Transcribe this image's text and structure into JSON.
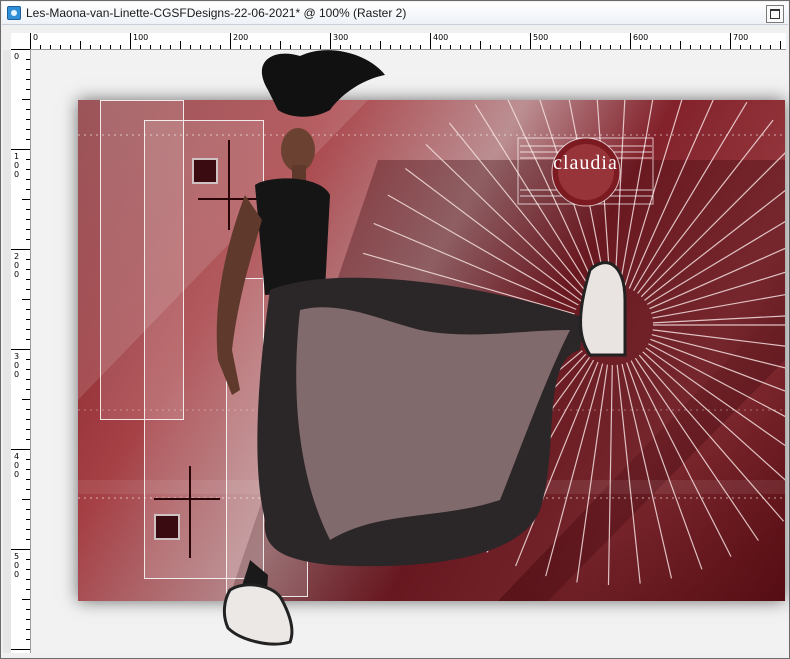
{
  "window": {
    "title": "Les-Maona-van-Linette-CGSFDesigns-22-06-2021* @ 100% (Raster 2)"
  },
  "ruler_top": {
    "labels": [
      "0",
      "100",
      "200",
      "300",
      "400",
      "500",
      "600",
      "700"
    ]
  },
  "ruler_left": {
    "labels": [
      "0",
      "100",
      "200",
      "300",
      "400",
      "500"
    ]
  },
  "artwork": {
    "watermark_text": "claudia",
    "colors": {
      "deep_red": "#5a0e15",
      "mid_red": "#a8464c",
      "pink": "#caa3a6",
      "dark_square": "#3a0b10"
    }
  },
  "icons": {
    "app": "paintshop-document-icon",
    "window_control": "maximize-icon"
  }
}
